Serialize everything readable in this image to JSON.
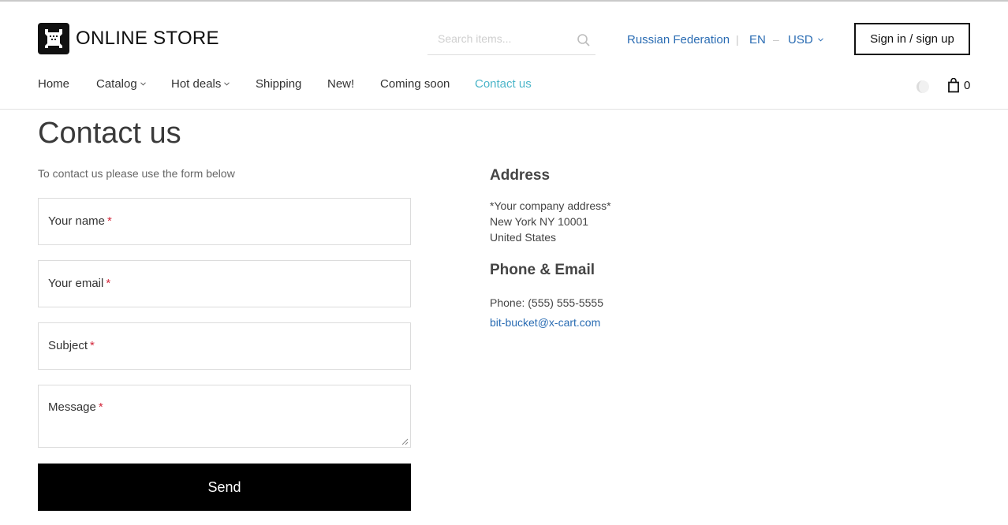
{
  "header": {
    "logo_text": "ONLINE STORE",
    "search_placeholder": "Search items...",
    "country": "Russian Federation",
    "language": "EN",
    "currency": "USD",
    "sign_in_label": "Sign in / sign up"
  },
  "nav": {
    "items": [
      {
        "label": "Home"
      },
      {
        "label": "Catalog",
        "has_dropdown": true
      },
      {
        "label": "Hot deals",
        "has_dropdown": true
      },
      {
        "label": "Shipping"
      },
      {
        "label": "New!"
      },
      {
        "label": "Coming soon"
      },
      {
        "label": "Contact us",
        "active": true
      }
    ],
    "cart_count": "0"
  },
  "main": {
    "title": "Contact us",
    "intro": "To contact us please use the form below",
    "form": {
      "name_label": "Your name",
      "email_label": "Your email",
      "subject_label": "Subject",
      "message_label": "Message",
      "required_mark": "*",
      "send_label": "Send"
    }
  },
  "contact_info": {
    "address_heading": "Address",
    "address_lines": [
      "*Your company address*",
      "New York NY 10001",
      "United States"
    ],
    "phone_heading": "Phone & Email",
    "phone": "Phone: (555) 555-5555",
    "email": "bit-bucket@x-cart.com"
  },
  "colors": {
    "accent_link": "#2a6cb3",
    "active_nav": "#4bb5c9",
    "required": "#d3283c",
    "button_bg": "#000000"
  }
}
